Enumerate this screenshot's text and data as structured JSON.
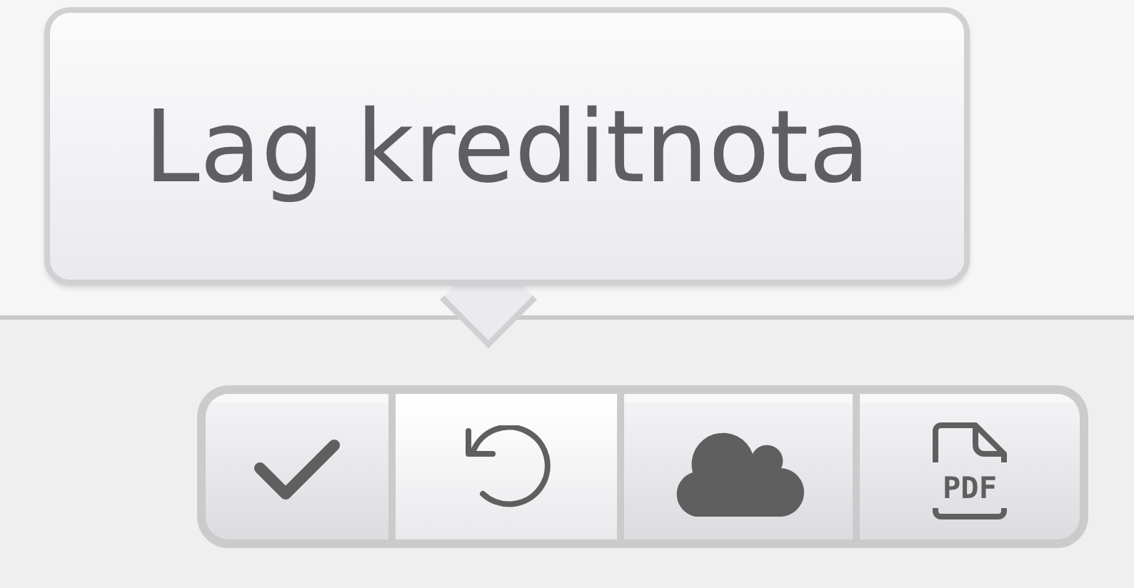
{
  "tooltip": {
    "text": "Lag kreditnota"
  },
  "toolbar": {
    "buttons": [
      {
        "kind": "check",
        "selected": false
      },
      {
        "kind": "undo",
        "selected": true
      },
      {
        "kind": "cloud",
        "selected": false
      },
      {
        "kind": "pdf",
        "label": "PDF",
        "selected": false
      }
    ]
  }
}
